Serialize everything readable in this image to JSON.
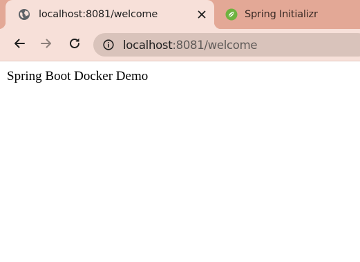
{
  "tabs": [
    {
      "title": "localhost:8081/welcome",
      "icon": "globe-icon",
      "active": true
    },
    {
      "title": "Spring Initializr",
      "icon": "spring-leaf-icon",
      "active": false
    }
  ],
  "toolbar": {
    "back_icon": "back-arrow-icon",
    "forward_icon": "forward-arrow-icon",
    "reload_icon": "reload-icon"
  },
  "address_bar": {
    "host": "localhost",
    "rest": ":8081/welcome",
    "site_info_icon": "info-icon"
  },
  "page": {
    "text": "Spring Boot Docker Demo"
  },
  "colors": {
    "tab_strip": "#e3a896",
    "active_tab": "#f7e0d9",
    "omnibox": "#d9c3bb",
    "spring_green": "#6db33f"
  }
}
